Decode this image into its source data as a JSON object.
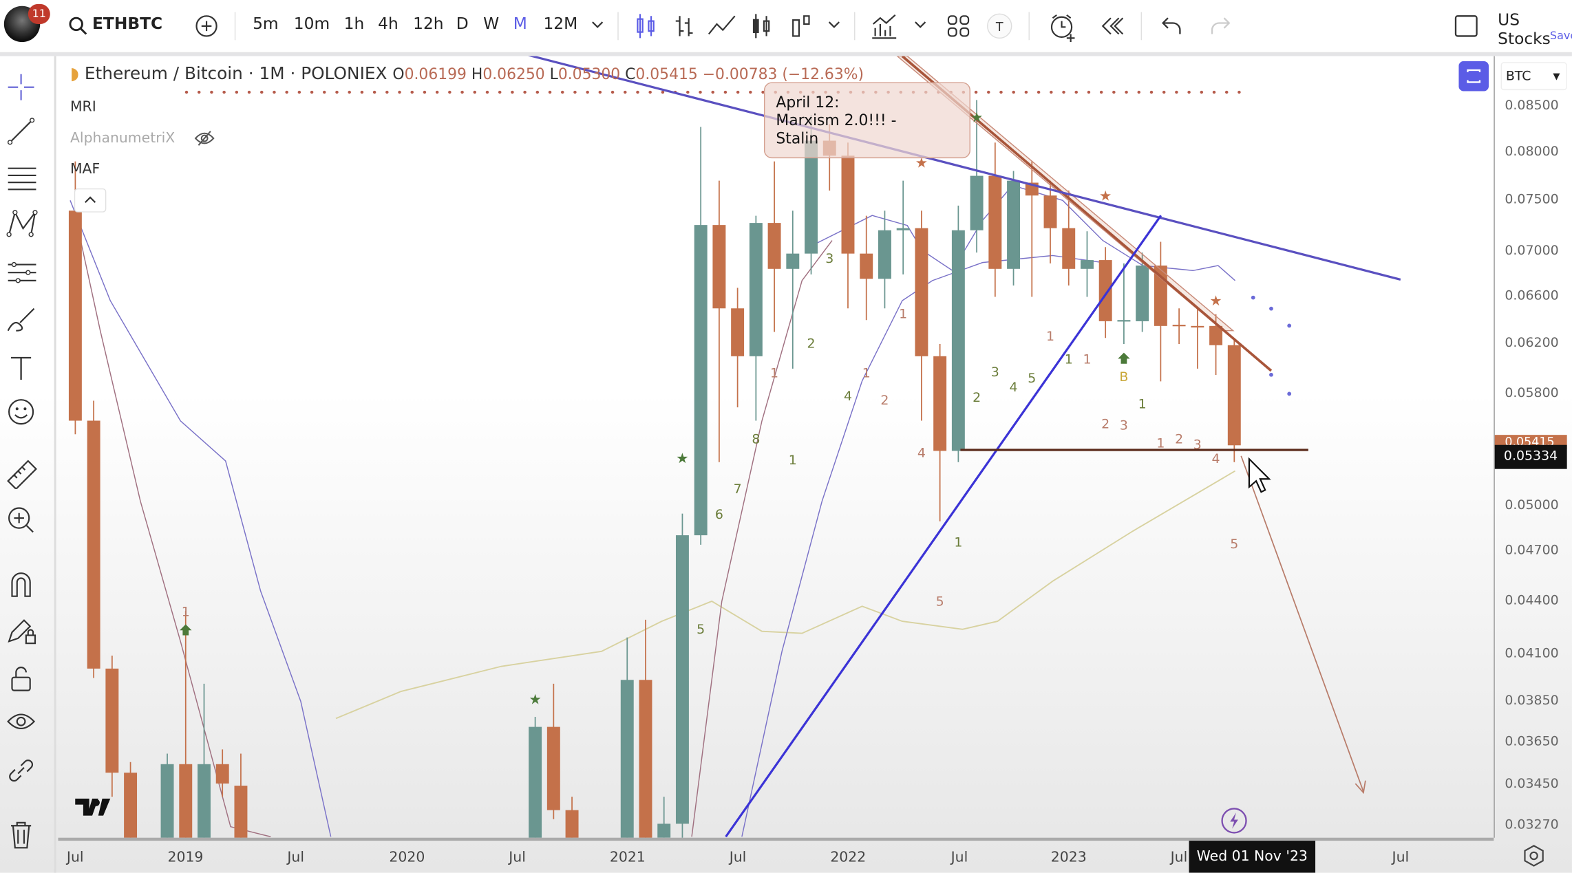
{
  "topbar": {
    "notification_count": "11",
    "symbol": "ETHBTC",
    "intervals": [
      "5m",
      "10m",
      "1h",
      "4h",
      "12h",
      "D",
      "W",
      "M",
      "12M"
    ],
    "active_interval": "M",
    "watchlist": "US Stocks",
    "save_label": "Save",
    "accent_color": "#5b5ce6"
  },
  "legend": {
    "title": "Ethereum / Bitcoin · 1M · POLONIEX",
    "open_label": "O",
    "open": "0.06199",
    "high_label": "H",
    "high": "0.06250",
    "low_label": "L",
    "low": "0.05300",
    "close_label": "C",
    "close": "0.05415",
    "change": "−0.00783 (−12.63%)"
  },
  "indicators": [
    {
      "name": "MRI",
      "visible": true
    },
    {
      "name": "AlphanumetriX",
      "visible": false
    },
    {
      "name": "MAF",
      "visible": true
    }
  ],
  "note": {
    "text": "April 12:\nMarxism 2.0!!! -\nStalin"
  },
  "price_axis": {
    "currency": "BTC",
    "ticks": [
      "0.08500",
      "0.08000",
      "0.07500",
      "0.07000",
      "0.06600",
      "0.06200",
      "0.05800",
      "0.05000",
      "0.04700",
      "0.04400",
      "0.04100",
      "0.03850",
      "0.03650",
      "0.03450",
      "0.03270"
    ],
    "current_price": "0.05334",
    "current_price_hidden": "0.05415"
  },
  "time_axis": {
    "ticks": [
      "Jul",
      "2019",
      "Jul",
      "2020",
      "Jul",
      "2021",
      "Jul",
      "2022",
      "Jul",
      "2023",
      "Jul",
      "Jul"
    ],
    "crosshair_label": "Wed 01 Nov '23"
  },
  "chart_data": {
    "type": "candlestick",
    "yscale": "log",
    "ylim": [
      0.0327,
      0.0855
    ],
    "xlim": [
      "2018-07",
      "2024-09"
    ],
    "up_color": "#6a9690",
    "down_color": "#c4714a",
    "candles": [
      [
        "2018-07",
        0.074,
        0.079,
        0.055,
        0.056
      ],
      [
        "2018-08",
        0.056,
        0.0575,
        0.0398,
        0.0403
      ],
      [
        "2018-09",
        0.0403,
        0.041,
        0.034,
        0.0351
      ],
      [
        "2018-10",
        0.0351,
        0.0356,
        0.03,
        0.031
      ],
      [
        "2018-12",
        0.031,
        0.036,
        0.03,
        0.0355
      ],
      [
        "2019-01",
        0.0355,
        0.0435,
        0.03,
        0.031
      ],
      [
        "2019-02",
        0.031,
        0.0395,
        0.03,
        0.0355
      ],
      [
        "2019-03",
        0.0355,
        0.0362,
        0.034,
        0.0346
      ],
      [
        "2019-04",
        0.0345,
        0.036,
        0.03,
        0.031
      ],
      [
        "2020-08",
        0.031,
        0.0378,
        0.03,
        0.0373
      ],
      [
        "2020-09",
        0.0373,
        0.0395,
        0.033,
        0.0334
      ],
      [
        "2020-10",
        0.0334,
        0.034,
        0.03,
        0.031
      ],
      [
        "2021-01",
        0.031,
        0.042,
        0.03,
        0.0397
      ],
      [
        "2021-02",
        0.0397,
        0.043,
        0.03,
        0.031
      ],
      [
        "2021-03",
        0.0322,
        0.034,
        0.031,
        0.0328
      ],
      [
        "2021-04",
        0.0328,
        0.0495,
        0.032,
        0.0481
      ],
      [
        "2021-05",
        0.0481,
        0.0827,
        0.0475,
        0.0726
      ],
      [
        "2021-06",
        0.0726,
        0.077,
        0.053,
        0.065
      ],
      [
        "2021-07",
        0.065,
        0.0668,
        0.057,
        0.061
      ],
      [
        "2021-08",
        0.061,
        0.0735,
        0.056,
        0.0728
      ],
      [
        "2021-09",
        0.0728,
        0.079,
        0.063,
        0.0685
      ],
      [
        "2021-10",
        0.0685,
        0.074,
        0.06,
        0.0699
      ],
      [
        "2021-11",
        0.0699,
        0.084,
        0.068,
        0.0812
      ],
      [
        "2021-12",
        0.0812,
        0.083,
        0.076,
        0.0796
      ],
      [
        "2022-01",
        0.0796,
        0.081,
        0.065,
        0.0699
      ],
      [
        "2022-02",
        0.0699,
        0.0735,
        0.064,
        0.0676
      ],
      [
        "2022-03",
        0.0676,
        0.074,
        0.065,
        0.0721
      ],
      [
        "2022-04",
        0.0721,
        0.077,
        0.068,
        0.0723
      ],
      [
        "2022-05",
        0.0723,
        0.074,
        0.056,
        0.061
      ],
      [
        "2022-06",
        0.061,
        0.062,
        0.049,
        0.0538
      ],
      [
        "2022-07",
        0.0538,
        0.0745,
        0.053,
        0.0721
      ],
      [
        "2022-08",
        0.0721,
        0.0857,
        0.07,
        0.0775
      ],
      [
        "2022-09",
        0.0775,
        0.081,
        0.066,
        0.0685
      ],
      [
        "2022-10",
        0.0685,
        0.078,
        0.067,
        0.077
      ],
      [
        "2022-11",
        0.0768,
        0.079,
        0.066,
        0.0755
      ],
      [
        "2022-12",
        0.0755,
        0.077,
        0.069,
        0.0723
      ],
      [
        "2023-01",
        0.0723,
        0.076,
        0.067,
        0.0685
      ],
      [
        "2023-02",
        0.0685,
        0.072,
        0.066,
        0.0693
      ],
      [
        "2023-03",
        0.0693,
        0.0705,
        0.0625,
        0.0639
      ],
      [
        "2023-04",
        0.0639,
        0.069,
        0.062,
        0.064
      ],
      [
        "2023-05",
        0.0639,
        0.07,
        0.063,
        0.0688
      ],
      [
        "2023-06",
        0.0688,
        0.071,
        0.059,
        0.0635
      ],
      [
        "2023-07",
        0.0636,
        0.065,
        0.062,
        0.0635
      ],
      [
        "2023-08",
        0.0635,
        0.065,
        0.06,
        0.0634
      ],
      [
        "2023-09",
        0.0635,
        0.0645,
        0.0595,
        0.0619
      ],
      [
        "2023-10",
        0.0619,
        0.0625,
        0.053,
        0.0542
      ]
    ],
    "counts": [
      {
        "text": "1",
        "date": "2019-01",
        "price": 0.0435,
        "color": "#b87c6a"
      },
      {
        "text": "3",
        "date": "2021-12",
        "price": 0.0695,
        "color": "#6b7d3a"
      },
      {
        "text": "2",
        "date": "2021-11",
        "price": 0.0621,
        "color": "#6b7d3a"
      },
      {
        "text": "1",
        "date": "2021-09",
        "price": 0.0597,
        "color": "#b87c6a"
      },
      {
        "text": "8",
        "date": "2021-08",
        "price": 0.0547,
        "color": "#6b7d3a"
      },
      {
        "text": "7",
        "date": "2021-07",
        "price": 0.0512,
        "color": "#6b7d3a"
      },
      {
        "text": "6",
        "date": "2021-06",
        "price": 0.0495,
        "color": "#6b7d3a"
      },
      {
        "text": "5",
        "date": "2021-05",
        "price": 0.0425,
        "color": "#6b7d3a"
      },
      {
        "text": "1",
        "date": "2021-10",
        "price": 0.0532,
        "color": "#6b7d3a"
      },
      {
        "text": "4",
        "date": "2022-01",
        "price": 0.0579,
        "color": "#6b7d3a"
      },
      {
        "text": "1",
        "date": "2022-02",
        "price": 0.0597,
        "color": "#b87c6a"
      },
      {
        "text": "2",
        "date": "2022-03",
        "price": 0.0576,
        "color": "#b87c6a"
      },
      {
        "text": "1",
        "date": "2022-04",
        "price": 0.0646,
        "color": "#b87c6a"
      },
      {
        "text": "4",
        "date": "2022-05",
        "price": 0.0537,
        "color": "#b87c6a"
      },
      {
        "text": "5",
        "date": "2022-06",
        "price": 0.0441,
        "color": "#b87c6a"
      },
      {
        "text": "1",
        "date": "2022-07",
        "price": 0.0477,
        "color": "#6b7d3a"
      },
      {
        "text": "2",
        "date": "2022-08",
        "price": 0.0578,
        "color": "#6b7d3a"
      },
      {
        "text": "3",
        "date": "2022-09",
        "price": 0.0598,
        "color": "#6b7d3a"
      },
      {
        "text": "4",
        "date": "2022-10",
        "price": 0.0586,
        "color": "#6b7d3a"
      },
      {
        "text": "5",
        "date": "2022-11",
        "price": 0.0593,
        "color": "#6b7d3a"
      },
      {
        "text": "1",
        "date": "2022-12",
        "price": 0.0627,
        "color": "#b87c6a"
      },
      {
        "text": "1",
        "date": "2023-01",
        "price": 0.0608,
        "color": "#6b7d3a"
      },
      {
        "text": "1",
        "date": "2023-02",
        "price": 0.0608,
        "color": "#b87c6a"
      },
      {
        "text": "2",
        "date": "2023-03",
        "price": 0.0558,
        "color": "#b87c6a"
      },
      {
        "text": "B",
        "date": "2023-04",
        "price": 0.0594,
        "color": "#c9a83a"
      },
      {
        "text": "3",
        "date": "2023-04",
        "price": 0.0557,
        "color": "#b87c6a"
      },
      {
        "text": "1",
        "date": "2023-05",
        "price": 0.0573,
        "color": "#6b7d3a"
      },
      {
        "text": "1",
        "date": "2023-06",
        "price": 0.0544,
        "color": "#b87c6a"
      },
      {
        "text": "2",
        "date": "2023-07",
        "price": 0.0547,
        "color": "#b87c6a"
      },
      {
        "text": "3",
        "date": "2023-08",
        "price": 0.0543,
        "color": "#b87c6a"
      },
      {
        "text": "4",
        "date": "2023-09",
        "price": 0.0533,
        "color": "#b87c6a"
      },
      {
        "text": "5",
        "date": "2023-10",
        "price": 0.0476,
        "color": "#b87c6a"
      }
    ],
    "markers": [
      {
        "shape": "star",
        "date": "2020-08",
        "price": 0.0387,
        "color": "#4c7a3a"
      },
      {
        "shape": "star",
        "date": "2021-04",
        "price": 0.0533,
        "color": "#4c7a3a"
      },
      {
        "shape": "star",
        "date": "2022-08",
        "price": 0.0838,
        "color": "#4c7a3a"
      },
      {
        "shape": "star",
        "date": "2022-05",
        "price": 0.0789,
        "color": "#c4714a"
      },
      {
        "shape": "star",
        "date": "2023-03",
        "price": 0.0755,
        "color": "#c4714a"
      },
      {
        "shape": "star",
        "date": "2023-09",
        "price": 0.0657,
        "color": "#c4714a"
      },
      {
        "shape": "arrow-up",
        "date": "2019-01",
        "price": 0.0424,
        "color": "#4c7a3a"
      },
      {
        "shape": "arrow-up",
        "date": "2023-04",
        "price": 0.0608,
        "color": "#4c7a3a"
      }
    ]
  }
}
